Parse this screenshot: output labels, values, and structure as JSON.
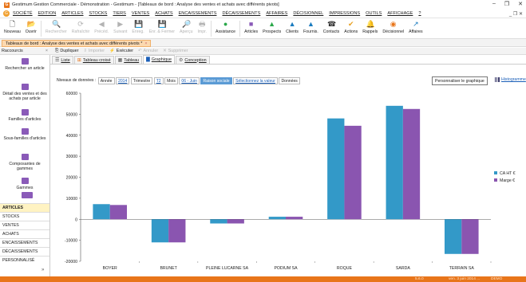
{
  "window": {
    "title": "Gestimum Gestion Commerciale - Démonstration - Gestimum - [Tableaux de bord : Analyse des ventes et achats avec différents pivots]",
    "controls": [
      "–",
      "❐",
      "✕"
    ]
  },
  "menu": {
    "items": [
      "SOCIÉTÉ",
      "EDITION",
      "ARTICLES",
      "STOCKS",
      "TIERS",
      "VENTES",
      "ACHATS",
      "ENCAISSEMENTS",
      "DÉCAISSEMENTS",
      "AFFAIRES",
      "DÉCISIONNEL",
      "IMPRESSIONS",
      "OUTILS",
      "AFFICHAGE",
      "?"
    ],
    "right_controls": "_ ❐ ✕"
  },
  "toolbar": {
    "buttons": [
      {
        "label": "Nouveau",
        "icon": "new-doc-icon",
        "glyph": "🗋",
        "enabled": true
      },
      {
        "label": "Ouvrir",
        "icon": "open-folder-icon",
        "glyph": "📂",
        "enabled": true
      },
      {
        "label": "Rechercher",
        "icon": "binoculars-icon",
        "glyph": "🔍",
        "enabled": false
      },
      {
        "label": "Rafraîchir",
        "icon": "refresh-icon",
        "glyph": "⟳",
        "enabled": false
      },
      {
        "label": "Précéd.",
        "icon": "previous-icon",
        "glyph": "◀",
        "enabled": false
      },
      {
        "label": "Suivant",
        "icon": "next-icon",
        "glyph": "▶",
        "enabled": false
      },
      {
        "label": "Enreg.",
        "icon": "save-icon",
        "glyph": "💾",
        "enabled": false
      },
      {
        "label": "Enr. & Fermer",
        "icon": "save-close-icon",
        "glyph": "💾",
        "enabled": false
      },
      {
        "label": "Aperçu",
        "icon": "preview-icon",
        "glyph": "🔎",
        "enabled": false
      },
      {
        "label": "Impr.",
        "icon": "print-icon",
        "glyph": "🖶",
        "enabled": false
      },
      {
        "label": "Assistance",
        "icon": "assistance-icon",
        "glyph": "●",
        "enabled": true,
        "color": "#2aa84a"
      },
      {
        "label": "Articles",
        "icon": "articles-icon",
        "glyph": "■",
        "enabled": true,
        "color": "#8a5ab8"
      },
      {
        "label": "Prospects",
        "icon": "prospects-icon",
        "glyph": "▲",
        "enabled": true,
        "color": "#2aa84a"
      },
      {
        "label": "Clients",
        "icon": "clients-icon",
        "glyph": "▲",
        "enabled": true,
        "color": "#1a7bbf"
      },
      {
        "label": "Fournis.",
        "icon": "suppliers-icon",
        "glyph": "▲",
        "enabled": true,
        "color": "#1a7bbf"
      },
      {
        "label": "Contacts",
        "icon": "contacts-icon",
        "glyph": "☎",
        "enabled": true,
        "color": "#333333"
      },
      {
        "label": "Actions",
        "icon": "actions-icon",
        "glyph": "✔",
        "enabled": true,
        "color": "#e8a020"
      },
      {
        "label": "Rappels",
        "icon": "reminders-icon",
        "glyph": "🔔",
        "enabled": true,
        "color": "#e8a020"
      },
      {
        "label": "Décisionnel",
        "icon": "decisionnel-icon",
        "glyph": "◉",
        "enabled": true,
        "color": "#e8751a"
      },
      {
        "label": "Affaires",
        "icon": "affaires-icon",
        "glyph": "↗",
        "enabled": true,
        "color": "#1a7bbf"
      }
    ]
  },
  "doc_tab": {
    "label": "Tableaux de bord : Analyse des ventes et achats avec différents pivots *",
    "close": "×"
  },
  "shortcut_panel": {
    "label": "Raccourcis",
    "close": "×"
  },
  "actions": [
    {
      "label": "Dupliquer",
      "glyph": "⎘",
      "enabled": true
    },
    {
      "label": "Importer",
      "glyph": "⇩",
      "enabled": false
    },
    {
      "label": "Exécuter",
      "glyph": "⚡",
      "enabled": true
    },
    {
      "label": "Annuler",
      "glyph": "↶",
      "enabled": false
    },
    {
      "label": "Supprimer",
      "glyph": "✕",
      "enabled": false
    }
  ],
  "sidebar": {
    "items": [
      {
        "label": "Rechercher un article",
        "icon": "search-article-icon"
      },
      {
        "label": "Détail des ventes et des achats par article",
        "icon": "sales-detail-icon"
      },
      {
        "label": "Familles d'articles",
        "icon": "article-families-icon"
      },
      {
        "label": "Sous-familles d'articles",
        "icon": "article-subfamilies-icon"
      },
      {
        "label": "Composantes de gammes",
        "icon": "range-components-icon"
      },
      {
        "label": "Gammes",
        "icon": "ranges-icon"
      }
    ],
    "nav": [
      "ARTICLES",
      "STOCKS",
      "VENTES",
      "ACHATS",
      "ENCAISSEMENTS",
      "DÉCAISSEMENTS",
      "PERSONNALISÉ"
    ],
    "active_nav": "ARTICLES"
  },
  "view_tabs": [
    {
      "label": "Liste",
      "icon": "list-icon",
      "glyph": "☰"
    },
    {
      "label": "Tableau croisé",
      "icon": "pivot-icon",
      "glyph": "⊞"
    },
    {
      "label": "Tableau",
      "icon": "table-icon",
      "glyph": "▦"
    },
    {
      "label": "Graphique",
      "icon": "chart-icon",
      "glyph": "▇",
      "active": true
    },
    {
      "label": "Conception",
      "icon": "design-icon",
      "glyph": "⚙"
    }
  ],
  "filters": {
    "prefix": "Niveaux de données :",
    "annee": "Année",
    "annee_value": "2014",
    "trimestre": "Trimestre",
    "trimestre_value": "T2",
    "mois": "Mois",
    "mois_value": "06 - Juin",
    "raison": "Raison sociale",
    "selection": "Sélectionnez la valeur",
    "donnees": "Données"
  },
  "chart_buttons": {
    "customize": "Personnaliser le graphique",
    "histogram": "Histogramme"
  },
  "chart_data": {
    "type": "bar",
    "categories": [
      "BOYER",
      "BRUNET",
      "PLEINE LUCARNE SA",
      "PODIUM SA",
      "ROQUE",
      "SARDA",
      "TERRAIN SA"
    ],
    "series": [
      {
        "name": "CA HT €",
        "color": "#3399c8",
        "values": [
          7200,
          -11000,
          -2000,
          1200,
          48000,
          54000,
          -16500
        ]
      },
      {
        "name": "Marge €",
        "color": "#8a55b0",
        "values": [
          6800,
          -11000,
          -2000,
          1200,
          44500,
          52500,
          -16500
        ]
      }
    ],
    "ylim": [
      -20000,
      60000
    ],
    "yticks": [
      -20000,
      -10000,
      0,
      10000,
      20000,
      30000,
      40000,
      50000,
      60000
    ],
    "grid": false,
    "legend": "right"
  },
  "status": {
    "version": "5.6.0",
    "user": "ADMIN",
    "date": "ven. 3 juin 2014 ...",
    "mode": "DEMO"
  }
}
